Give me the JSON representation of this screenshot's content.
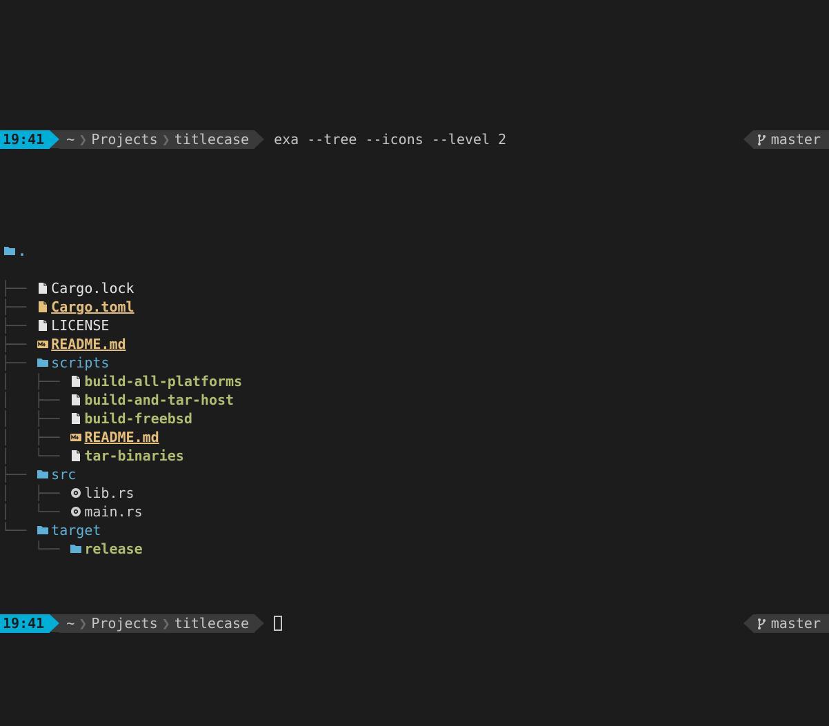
{
  "prompt_top": {
    "time": "19:41",
    "path_segments": [
      "~",
      "Projects",
      "titlecase"
    ],
    "command": "exa --tree --icons --level 2",
    "git_branch": "master"
  },
  "tree": {
    "root": ".",
    "entries": [
      {
        "depth": 1,
        "last": false,
        "icon": "file",
        "name": "Cargo.lock",
        "style": "c-white"
      },
      {
        "depth": 1,
        "last": false,
        "icon": "cfg",
        "name": "Cargo.toml",
        "style": "c-yellow"
      },
      {
        "depth": 1,
        "last": false,
        "icon": "file",
        "name": "LICENSE",
        "style": "c-white"
      },
      {
        "depth": 1,
        "last": false,
        "icon": "md",
        "name": "README.md",
        "style": "c-yellow"
      },
      {
        "depth": 1,
        "last": false,
        "icon": "folder",
        "name": "scripts",
        "style": "c-blue"
      },
      {
        "depth": 2,
        "last": false,
        "icon": "file",
        "name": "build-all-platforms",
        "style": "c-green"
      },
      {
        "depth": 2,
        "last": false,
        "icon": "file",
        "name": "build-and-tar-host",
        "style": "c-green"
      },
      {
        "depth": 2,
        "last": false,
        "icon": "file",
        "name": "build-freebsd",
        "style": "c-green"
      },
      {
        "depth": 2,
        "last": false,
        "icon": "md",
        "name": "README.md",
        "style": "c-yellow"
      },
      {
        "depth": 2,
        "last": true,
        "icon": "file",
        "name": "tar-binaries",
        "style": "c-green"
      },
      {
        "depth": 1,
        "last": false,
        "icon": "folder",
        "name": "src",
        "style": "c-blue"
      },
      {
        "depth": 2,
        "last": false,
        "icon": "rust",
        "name": "lib.rs",
        "style": "c-rust"
      },
      {
        "depth": 2,
        "last": true,
        "icon": "rust",
        "name": "main.rs",
        "style": "c-rust"
      },
      {
        "depth": 1,
        "last": true,
        "icon": "folder",
        "name": "target",
        "style": "c-blue"
      },
      {
        "depth": 2,
        "last": true,
        "icon": "folder",
        "name": "release",
        "style": "c-green",
        "parent_last": true
      }
    ]
  },
  "prompt_bottom": {
    "time": "19:41",
    "path_segments": [
      "~",
      "Projects",
      "titlecase"
    ],
    "git_branch": "master"
  },
  "sep_glyph": "❯"
}
